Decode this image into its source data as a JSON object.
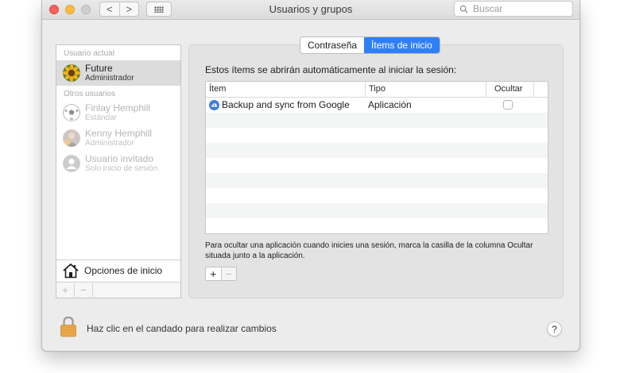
{
  "window": {
    "title": "Usuarios y grupos",
    "nav_back": "<",
    "nav_forward": ">"
  },
  "search": {
    "placeholder": "Buscar",
    "value": ""
  },
  "sidebar": {
    "current_user_label": "Usuario actual",
    "other_users_label": "Otros usuarios",
    "users": [
      {
        "name": "Future",
        "role": "Administrador",
        "avatar": "sunflower-avatar",
        "selected": true
      },
      {
        "name": "Finlay Hemphill",
        "role": "Estándar",
        "avatar": "soccer-ball-avatar",
        "selected": false
      },
      {
        "name": "Kenny Hemphill",
        "role": "Administrador",
        "avatar": "photo-avatar",
        "selected": false
      },
      {
        "name": "Usuario invitado",
        "role": "Solo inicio de sesión",
        "avatar": "generic-user-avatar",
        "selected": false
      }
    ],
    "login_options_label": "Opciones de inicio",
    "add_label": "+",
    "remove_label": "−"
  },
  "tabs": [
    {
      "label": "Contraseña",
      "active": false
    },
    {
      "label": "Ítems de inicio",
      "active": true
    }
  ],
  "main": {
    "heading": "Estos ítems se abrirán automáticamente al iniciar la sesión:",
    "columns": [
      "Ítem",
      "Tipo",
      "Ocultar"
    ],
    "rows": [
      {
        "item": "Backup and sync from Google",
        "type": "Aplicación",
        "hide": false,
        "icon": "google-backup-cloud-icon"
      }
    ],
    "hint": "Para ocultar una aplicación cuando inicies una sesión, marca la casilla de la columna Ocultar situada junto a la aplicación.",
    "add_label": "+",
    "remove_label": "−"
  },
  "footer": {
    "lock_text": "Haz clic en el candado para realizar cambios",
    "help_label": "?"
  },
  "colors": {
    "accent": "#2f7ff7",
    "window_bg": "#ececec",
    "selected_row": "#dcdcdc",
    "close": "#fc605c",
    "minimize": "#fdbc40"
  }
}
